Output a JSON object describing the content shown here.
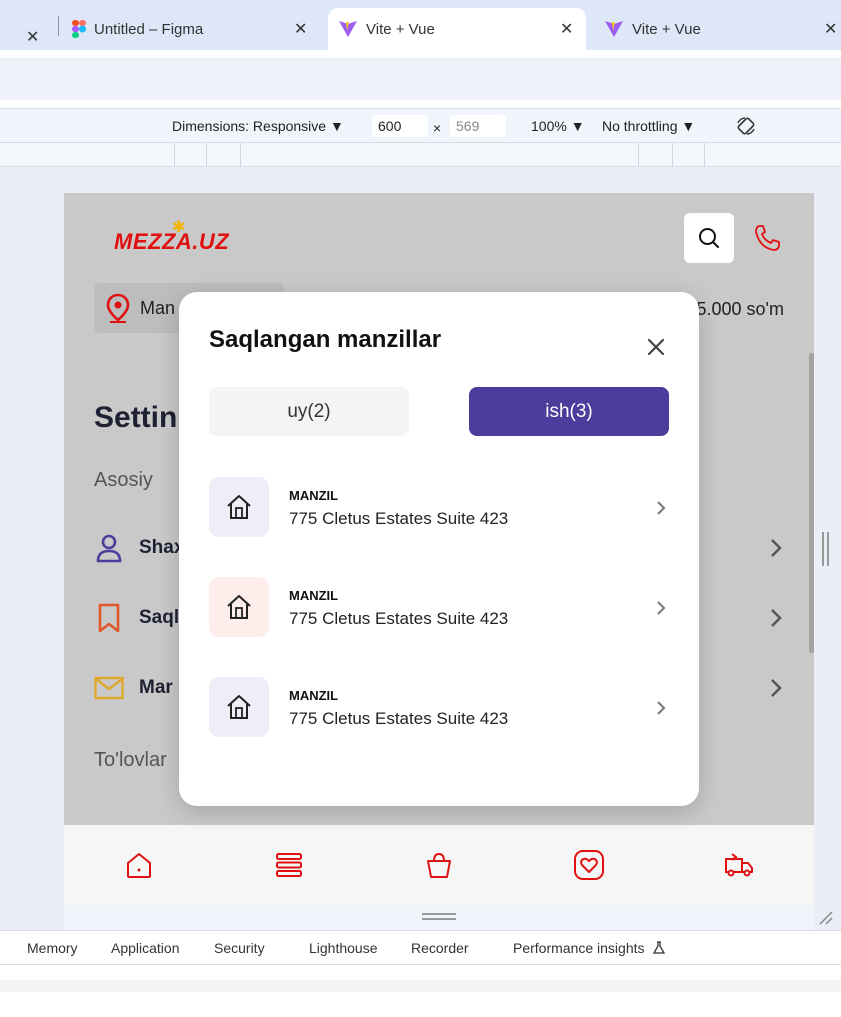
{
  "browser": {
    "tabs": [
      {
        "label": "Untitled – Figma",
        "active": false
      },
      {
        "label": "Vite + Vue",
        "active": true
      },
      {
        "label": "Vite + Vue",
        "active": false
      }
    ]
  },
  "devtools": {
    "dimensions_label": "Dimensions: Responsive",
    "width_value": "600",
    "times": "×",
    "height_placeholder": "569",
    "zoom": "100%",
    "throttling": "No throttling",
    "bottom_tabs": [
      "Memory",
      "Application",
      "Security",
      "Lighthouse",
      "Recorder",
      "Performance insights"
    ]
  },
  "app": {
    "logo": "MEZZA.UZ",
    "location_text": "Man",
    "price_text": "5.000 so'm",
    "settings_title": "Settin",
    "section_basic": "Asosiy",
    "rows": [
      {
        "label": "Shax"
      },
      {
        "label": "Saql"
      },
      {
        "label": "Mar"
      }
    ],
    "section_payments": "To'lovlar"
  },
  "modal": {
    "title": "Saqlangan manzillar",
    "tabs": [
      {
        "label": "uy(2)",
        "active": false
      },
      {
        "label": "ish(3)",
        "active": true
      }
    ],
    "addresses": [
      {
        "label": "MANZIL",
        "text": "775 Cletus Estates Suite 423",
        "icon_bg": "#efedf7"
      },
      {
        "label": "MANZIL",
        "text": "775 Cletus Estates Suite 423",
        "icon_bg": "#fdeeeb"
      },
      {
        "label": "MANZIL",
        "text": "775 Cletus Estates Suite 423",
        "icon_bg": "#efedf7"
      }
    ]
  },
  "colors": {
    "accent": "#4e3c9c",
    "brand_red": "#e01010"
  }
}
